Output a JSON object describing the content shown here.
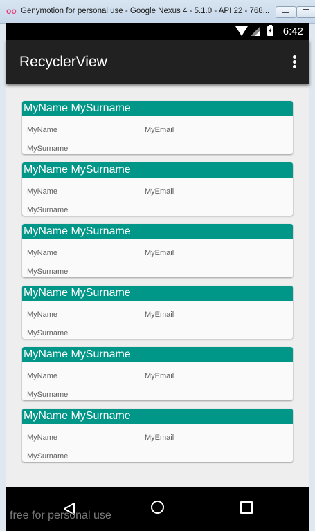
{
  "window": {
    "title": "Genymotion for personal use - Google Nexus 4 - 5.1.0 - API 22 - 768...",
    "app_icon_glyph": "oo"
  },
  "statusbar": {
    "time": "6:42",
    "icons": [
      "wifi-icon",
      "signal-icon",
      "battery-charging-icon"
    ]
  },
  "appbar": {
    "title": "RecyclerView",
    "menu_icon": "overflow-menu-icon"
  },
  "cards": [
    {
      "title": "MyName MySurname",
      "name": "MyName",
      "email": "MyEmail",
      "surname": "MySurname"
    },
    {
      "title": "MyName MySurname",
      "name": "MyName",
      "email": "MyEmail",
      "surname": "MySurname"
    },
    {
      "title": "MyName MySurname",
      "name": "MyName",
      "email": "MyEmail",
      "surname": "MySurname"
    },
    {
      "title": "MyName MySurname",
      "name": "MyName",
      "email": "MyEmail",
      "surname": "MySurname"
    },
    {
      "title": "MyName MySurname",
      "name": "MyName",
      "email": "MyEmail",
      "surname": "MySurname"
    },
    {
      "title": "MyName MySurname",
      "name": "MyName",
      "email": "MyEmail",
      "surname": "MySurname"
    }
  ],
  "navbar": {
    "icons": [
      "back-icon",
      "home-icon",
      "recents-icon"
    ]
  },
  "watermark": "free for personal use",
  "colors": {
    "card_header": "#009688",
    "appbar": "#212121",
    "content_background": "#eeeeee"
  }
}
